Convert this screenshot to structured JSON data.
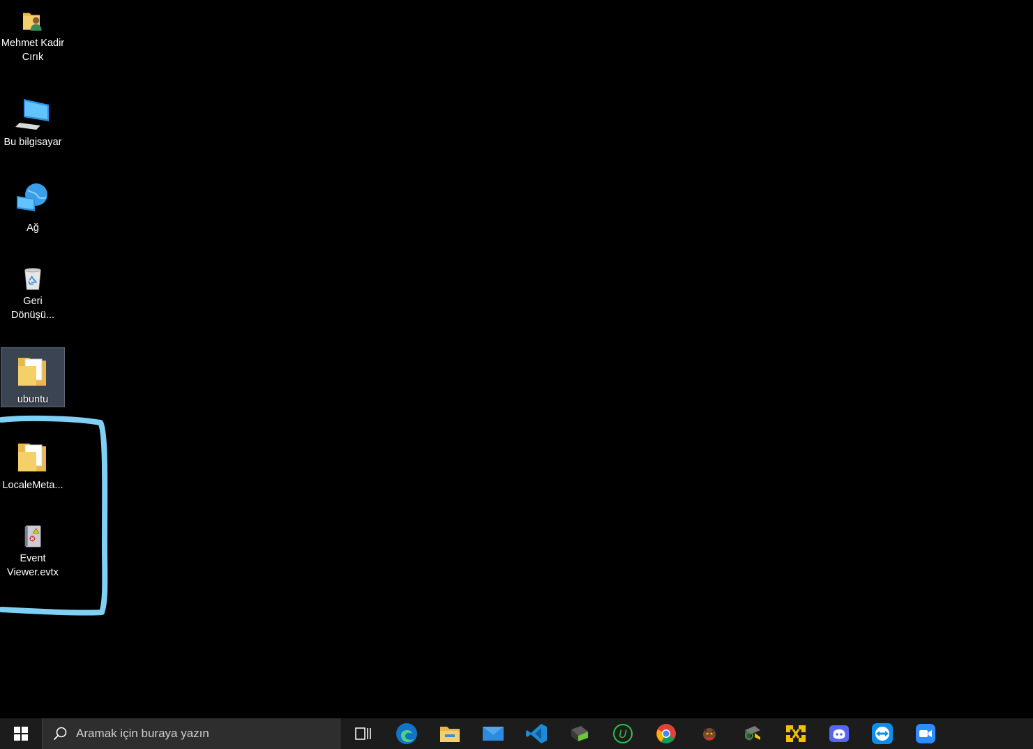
{
  "desktop": {
    "icons": [
      {
        "label": "Mehmet Kadir Cırık",
        "icon": "user-folder-icon"
      },
      {
        "label": "Bu bilgisayar",
        "icon": "computer-icon"
      },
      {
        "label": "Ağ",
        "icon": "network-icon"
      },
      {
        "label": "Geri Dönüşü...",
        "icon": "recycle-bin-icon"
      },
      {
        "label": "ubuntu",
        "icon": "folder-icon",
        "selected": true
      },
      {
        "label": "LocaleMeta...",
        "icon": "folder-icon"
      },
      {
        "label": "Event Viewer.evtx",
        "icon": "event-viewer-file-icon"
      }
    ],
    "annotation_color": "#7fd0f5"
  },
  "taskbar": {
    "search_placeholder": "Aramak için buraya yazın",
    "apps": [
      "task-view-icon",
      "edge-icon",
      "file-explorer-icon",
      "mail-icon",
      "vscode-icon",
      "gpg-icon",
      "upwork-icon",
      "chrome-icon",
      "game-icon",
      "tool-icon",
      "vmware-icon",
      "discord-icon",
      "teamviewer-icon",
      "zoom-icon"
    ]
  }
}
